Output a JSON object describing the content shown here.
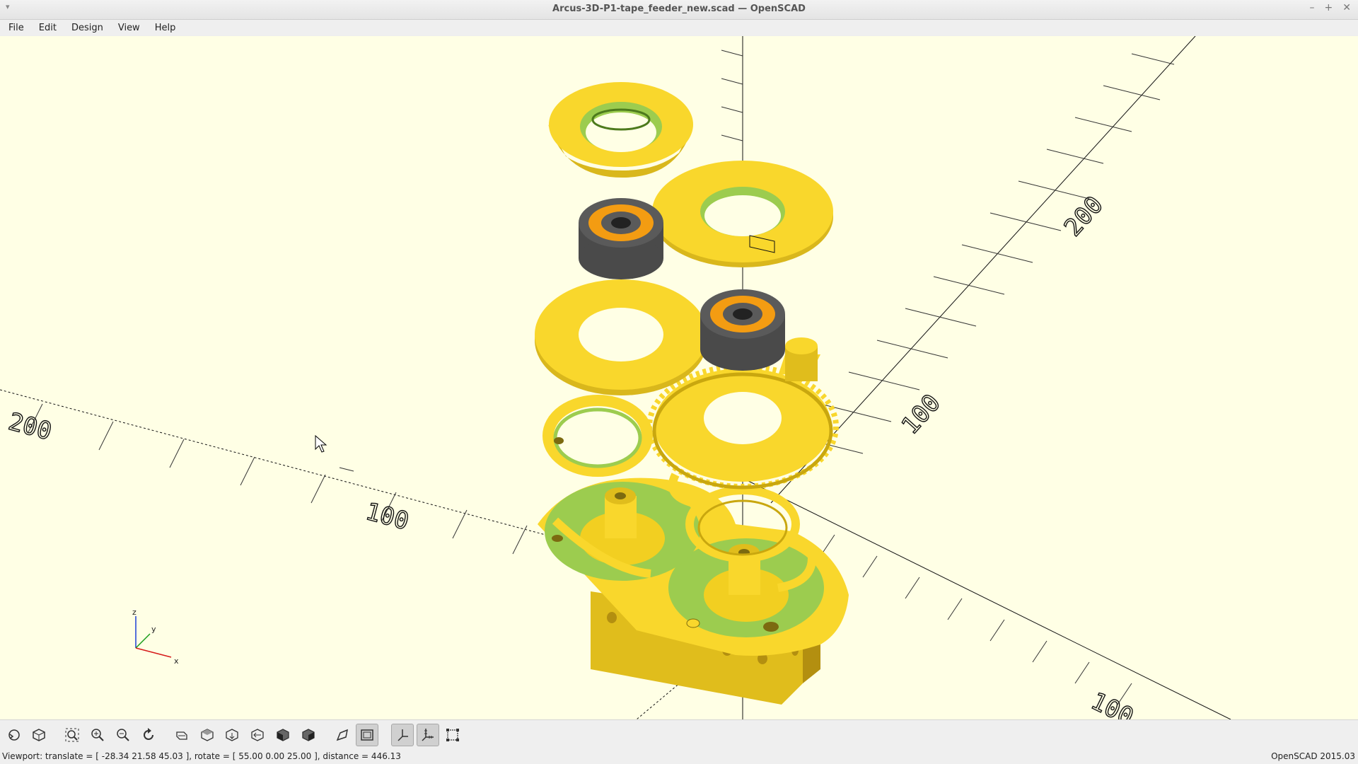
{
  "window": {
    "title": "Arcus-3D-P1-tape_feeder_new.scad — OpenSCAD",
    "controls": [
      "minimize-icon",
      "maximize-icon",
      "close-icon"
    ]
  },
  "menu": {
    "items": [
      {
        "label": "File"
      },
      {
        "label": "Edit"
      },
      {
        "label": "Design"
      },
      {
        "label": "View"
      },
      {
        "label": "Help"
      }
    ]
  },
  "viewport": {
    "background": "#ffffe5",
    "axis_ticks": {
      "left_200": "200",
      "left_100": "100",
      "right_100": "100",
      "back_100": "100",
      "back_200": "200"
    },
    "axis_indicator": {
      "z": "z",
      "y": "y",
      "x": "x"
    },
    "colors": {
      "part": "#f9d72c",
      "part_shadow": "#c9a70f",
      "inner": "#9ccc4f",
      "bearing": "#f39c12",
      "bearing_body": "#4a4a4a"
    }
  },
  "toolbar": {
    "buttons": [
      {
        "icon": "preview-icon"
      },
      {
        "icon": "render-icon"
      },
      {
        "icon": "view-all-icon"
      },
      {
        "icon": "zoom-in-icon"
      },
      {
        "icon": "zoom-out-icon"
      },
      {
        "icon": "reset-view-icon"
      },
      {
        "icon": "view-right-icon"
      },
      {
        "icon": "view-top-icon"
      },
      {
        "icon": "view-bottom-icon"
      },
      {
        "icon": "view-left-icon"
      },
      {
        "icon": "view-front-icon"
      },
      {
        "icon": "view-back-icon"
      },
      {
        "icon": "perspective-icon"
      },
      {
        "icon": "orthogonal-icon",
        "active": true
      },
      {
        "icon": "show-axes-icon",
        "active": true
      },
      {
        "icon": "show-scale-markers-icon",
        "active": true
      },
      {
        "icon": "show-edges-icon"
      }
    ]
  },
  "status": {
    "viewport_info": "Viewport: translate = [ -28.34 21.58 45.03 ], rotate = [ 55.00 0.00 25.00 ], distance = 446.13",
    "version": "OpenSCAD 2015.03"
  }
}
